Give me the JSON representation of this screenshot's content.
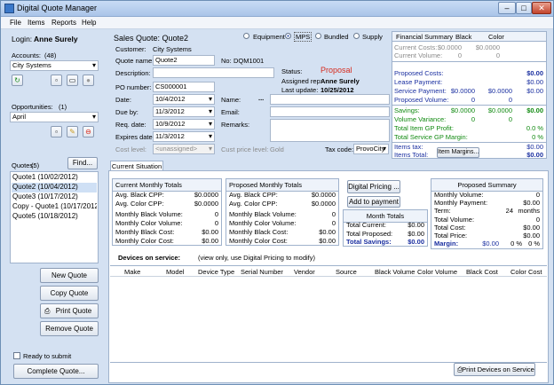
{
  "window": {
    "title": "Digital Quote Manager",
    "min": "–",
    "max": "□",
    "close": "✕"
  },
  "menu": [
    "File",
    "Items",
    "Reports",
    "Help"
  ],
  "left": {
    "login_label": "Login:",
    "login_user": "Anne Surely",
    "accounts_label": "Accounts:",
    "accounts_count": "(48)",
    "account_selected": "City Systems",
    "opportunities_label": "Opportunities:",
    "opportunities_count": "(1)",
    "opportunity_selected": "April",
    "quotes_label": "Quotes:",
    "quotes_count": "(5)",
    "find_label": "Find...",
    "quotes": [
      "Quote1 (10/02/2012)",
      "Quote2 (10/04/2012)",
      "Quote3 (10/17/2012)",
      "Copy - Quote1 (10/17/2012",
      "Quote5 (10/18/2012)"
    ],
    "new_quote": "New Quote",
    "copy_quote": "Copy Quote",
    "print_quote": "Print Quote",
    "remove_quote": "Remove Quote",
    "ready_label": "Ready to submit",
    "complete_quote": "Complete Quote..."
  },
  "quote": {
    "title": "Sales Quote: Quote2",
    "radio_options": [
      "Equipment",
      "MPS",
      "Bundled",
      "Supply"
    ],
    "radio_selected": "MPS",
    "customer_label": "Customer:",
    "customer": "City Systems",
    "quote_name_label": "Quote name:",
    "quote_name": "Quote2",
    "no_label": "No:",
    "no": "DQM1001",
    "description_label": "Description:",
    "po_label": "PO number:",
    "po": "CS000001",
    "status_label": "Status:",
    "status": "Proposal",
    "assigned_label": "Assigned rep:",
    "assigned": "Anne Surely",
    "last_update_label": "Last update:",
    "last_update": "10/25/2012",
    "date_label": "Date:",
    "date": "10/4/2012",
    "due_label": "Due by:",
    "due": "11/3/2012",
    "req_label": "Req. date:",
    "req": "10/9/2012",
    "expires_label": "Expires date:",
    "expires": "11/3/2012",
    "name_label": "Name:",
    "email_label": "Email:",
    "remarks_label": "Remarks:",
    "dots": "...",
    "cost_level_label": "Cost level:",
    "cost_level": "<unassigned>",
    "cust_price_label": "Cust price level:",
    "cust_price": "Gold",
    "tax_label": "Tax code:",
    "tax": "ProvoCity"
  },
  "financial": {
    "title": "Financial Summary",
    "col_black": "Black",
    "col_color": "Color",
    "current_costs_label": "Current Costs:",
    "current_costs_black": "$0.0000",
    "current_costs_color": "$0.0000",
    "current_volume_label": "Current Volume:",
    "current_volume_black": "0",
    "current_volume_color": "0",
    "proposed_costs_label": "Proposed Costs:",
    "proposed_costs": "$0.00",
    "lease_label": "Lease Payment:",
    "lease": "$0.00",
    "service_label": "Service Payment:",
    "service_black": "$0.0000",
    "service_color": "$0.0000",
    "service_total": "$0.00",
    "proposed_volume_label": "Proposed Volume:",
    "proposed_volume_black": "0",
    "proposed_volume_color": "0",
    "savings_label": "Savings:",
    "savings_black": "$0.0000",
    "savings_color": "$0.0000",
    "savings_total": "$0.00",
    "volume_variance_label": "Volume Variance:",
    "volume_variance_black": "0",
    "volume_variance_color": "0",
    "total_item_gp_label": "Total Item GP Profit:",
    "total_item_gp": "0.0 %",
    "total_service_gp_label": "Total Service GP Margin:",
    "total_service_gp": "0 %",
    "items_tax_label": "Items tax:",
    "items_tax": "$0.00",
    "items_total_label": "Items Total:",
    "items_total": "$0.00",
    "item_margins": "Item Margins..."
  },
  "tabs": {
    "current_situation": "Current Situation"
  },
  "current_totals": {
    "title": "Current Monthly Totals",
    "rows": [
      {
        "l": "Avg. Black CPP:",
        "v": "$0.0000"
      },
      {
        "l": "Avg. Color CPP:",
        "v": "$0.0000"
      },
      {
        "l": "Monthly Black Volume:",
        "v": "0"
      },
      {
        "l": "Monthly Color Volume:",
        "v": "0"
      },
      {
        "l": "Monthly Black Cost:",
        "v": "$0.00"
      },
      {
        "l": "Monthly Color Cost:",
        "v": "$0.00"
      }
    ]
  },
  "proposed_totals": {
    "title": "Proposed Monthly Totals",
    "rows": [
      {
        "l": "Avg. Black CPP:",
        "v": "$0.0000"
      },
      {
        "l": "Avg. Color CPP:",
        "v": "$0.0000"
      },
      {
        "l": "Monthly Black Volume:",
        "v": "0"
      },
      {
        "l": "Monthly Color Volume:",
        "v": "0"
      },
      {
        "l": "Monthly Black Cost:",
        "v": "$0.00"
      },
      {
        "l": "Monthly Color Cost:",
        "v": "$0.00"
      }
    ]
  },
  "middle": {
    "digital_pricing": "Digital Pricing ...",
    "add_to_payment": "Add to payment",
    "month_totals": "Month Totals",
    "total_current_label": "Total Current:",
    "total_current": "$0.00",
    "total_proposed_label": "Total Proposed:",
    "total_proposed": "$0.00",
    "total_savings_label": "Total Savings:",
    "total_savings": "$0.00"
  },
  "proposed_summary": {
    "title": "Proposed Summary",
    "monthly_volume_label": "Monthly Volume:",
    "monthly_volume": "0",
    "monthly_payment_label": "Monthly Payment:",
    "monthly_payment": "$0.00",
    "term_label": "Term:",
    "term_value": "24",
    "term_unit": "months",
    "total_volume_label": "Total Volume:",
    "total_volume": "0",
    "total_cost_label": "Total Cost:",
    "total_cost": "$0.00",
    "total_price_label": "Total Price:",
    "total_price": "$0.00",
    "margin_label": "Margin:",
    "margin_amount": "$0.00",
    "margin_pct1": "0 %",
    "margin_pct2": "0 %"
  },
  "devices": {
    "title": "Devices on service:",
    "note": "(view only, use Digital Pricing to modify)",
    "columns": [
      "Make",
      "Model",
      "Device Type",
      "Serial Number",
      "Vendor",
      "Source",
      "Black Volume",
      "Color Volume",
      "Black Cost",
      "Color Cost"
    ],
    "print_button": "Print Devices on Service"
  },
  "colors": {
    "accent_blue": "#1a2fa0",
    "status_red": "#d62b1e",
    "savings_green": "#118a11"
  }
}
